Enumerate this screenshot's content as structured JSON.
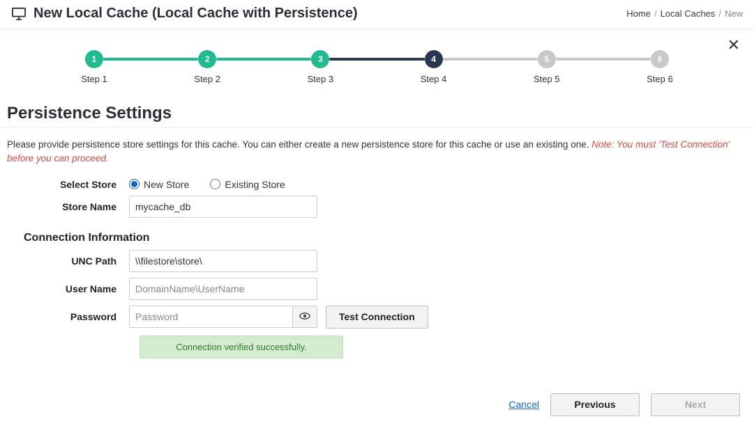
{
  "header": {
    "title": "New Local Cache (Local Cache with Persistence)",
    "breadcrumb": {
      "home": "Home",
      "local_caches": "Local Caches",
      "current": "New"
    }
  },
  "stepper": {
    "steps": [
      {
        "num": "1",
        "label": "Step 1",
        "state": "done"
      },
      {
        "num": "2",
        "label": "Step 2",
        "state": "done"
      },
      {
        "num": "3",
        "label": "Step 3",
        "state": "done"
      },
      {
        "num": "4",
        "label": "Step 4",
        "state": "current"
      },
      {
        "num": "5",
        "label": "Step 5",
        "state": "todo"
      },
      {
        "num": "6",
        "label": "Step 6",
        "state": "todo"
      }
    ]
  },
  "section": {
    "title": "Persistence Settings",
    "instruction_plain": "Please provide persistence store settings for this cache. You can either create a new persistence store for this cache or use an existing one. ",
    "instruction_note": "Note: You must 'Test Connection' before you can proceed."
  },
  "form": {
    "select_store_label": "Select Store",
    "radio_new": "New Store",
    "radio_existing": "Existing Store",
    "selected_store": "new",
    "store_name_label": "Store Name",
    "store_name_value": "mycache_db",
    "connection_info_title": "Connection Information",
    "unc_path_label": "UNC Path",
    "unc_path_value": "\\\\filestore\\store\\",
    "user_name_label": "User Name",
    "user_name_placeholder": "DomainName\\UserName",
    "user_name_value": "",
    "password_label": "Password",
    "password_placeholder": "Password",
    "password_value": "",
    "test_connection_label": "Test Connection",
    "alert_text": "Connection verified successfully."
  },
  "footer": {
    "cancel": "Cancel",
    "previous": "Previous",
    "next": "Next"
  },
  "colors": {
    "accent_done": "#20bb91",
    "accent_current": "#2b3650",
    "accent_todo": "#c8c8c8"
  }
}
